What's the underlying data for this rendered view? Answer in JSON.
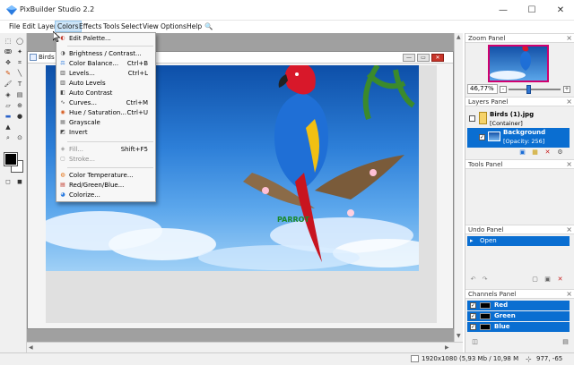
{
  "window": {
    "title": "PixBuilder Studio 2.2",
    "minimize": "—",
    "maximize": "☐",
    "close": "✕"
  },
  "menubar": [
    "File",
    "Edit",
    "Layer",
    "Colors",
    "Effects",
    "Tools",
    "Select",
    "View",
    "Options",
    "Help",
    "🔍"
  ],
  "colors_menu": [
    {
      "label": "Edit Palette...",
      "shortcut": "",
      "icon": "palette-icon",
      "disabled": false
    },
    {
      "sep": true
    },
    {
      "label": "Brightness / Contrast...",
      "shortcut": "",
      "icon": "brightness-icon",
      "disabled": false
    },
    {
      "label": "Color Balance...",
      "shortcut": "Ctrl+B",
      "icon": "color-balance-icon",
      "disabled": false
    },
    {
      "label": "Levels...",
      "shortcut": "Ctrl+L",
      "icon": "levels-icon",
      "disabled": false
    },
    {
      "label": "Auto Levels",
      "shortcut": "",
      "icon": "auto-levels-icon",
      "disabled": false
    },
    {
      "label": "Auto Contrast",
      "shortcut": "",
      "icon": "auto-contrast-icon",
      "disabled": false
    },
    {
      "label": "Curves...",
      "shortcut": "Ctrl+M",
      "icon": "curves-icon",
      "disabled": false
    },
    {
      "label": "Hue / Saturation...",
      "shortcut": "Ctrl+U",
      "icon": "hue-saturation-icon",
      "disabled": false
    },
    {
      "label": "Grayscale",
      "shortcut": "",
      "icon": "grayscale-icon",
      "disabled": false
    },
    {
      "label": "Invert",
      "shortcut": "",
      "icon": "invert-icon",
      "disabled": false
    },
    {
      "sep": true
    },
    {
      "label": "Fill...",
      "shortcut": "Shift+F5",
      "icon": "fill-icon",
      "disabled": true
    },
    {
      "label": "Stroke...",
      "shortcut": "",
      "icon": "stroke-icon",
      "disabled": true
    },
    {
      "sep": true
    },
    {
      "label": "Color Temperature...",
      "shortcut": "",
      "icon": "temperature-icon",
      "disabled": false
    },
    {
      "label": "Red/Green/Blue...",
      "shortcut": "",
      "icon": "rgb-icon",
      "disabled": false
    },
    {
      "label": "Colorize...",
      "shortcut": "",
      "icon": "colorize-icon",
      "disabled": false
    }
  ],
  "document": {
    "title": "Birds (1",
    "image_text": "PARROT"
  },
  "panels": {
    "zoom": {
      "title": "Zoom Panel",
      "value": "46,77%",
      "minus": "-",
      "plus": "+"
    },
    "layers": {
      "title": "Layers Panel",
      "items": [
        {
          "name": "Birds (1).jpg",
          "sub": "[Container]"
        },
        {
          "name": "Background",
          "sub": "[Opacity: 256]"
        }
      ]
    },
    "tools": {
      "title": "Tools Panel"
    },
    "undo": {
      "title": "Undo Panel",
      "items": [
        "Open"
      ]
    },
    "channels": {
      "title": "Channels Panel",
      "items": [
        "Red",
        "Green",
        "Blue"
      ]
    }
  },
  "status": {
    "size": "1920x1080",
    "memory": "(5,93 Mb / 10,98 M",
    "coords": "977, -65"
  },
  "colors": {
    "accent": "#0a6ed1",
    "menu_highlight": "#cce4f7"
  }
}
